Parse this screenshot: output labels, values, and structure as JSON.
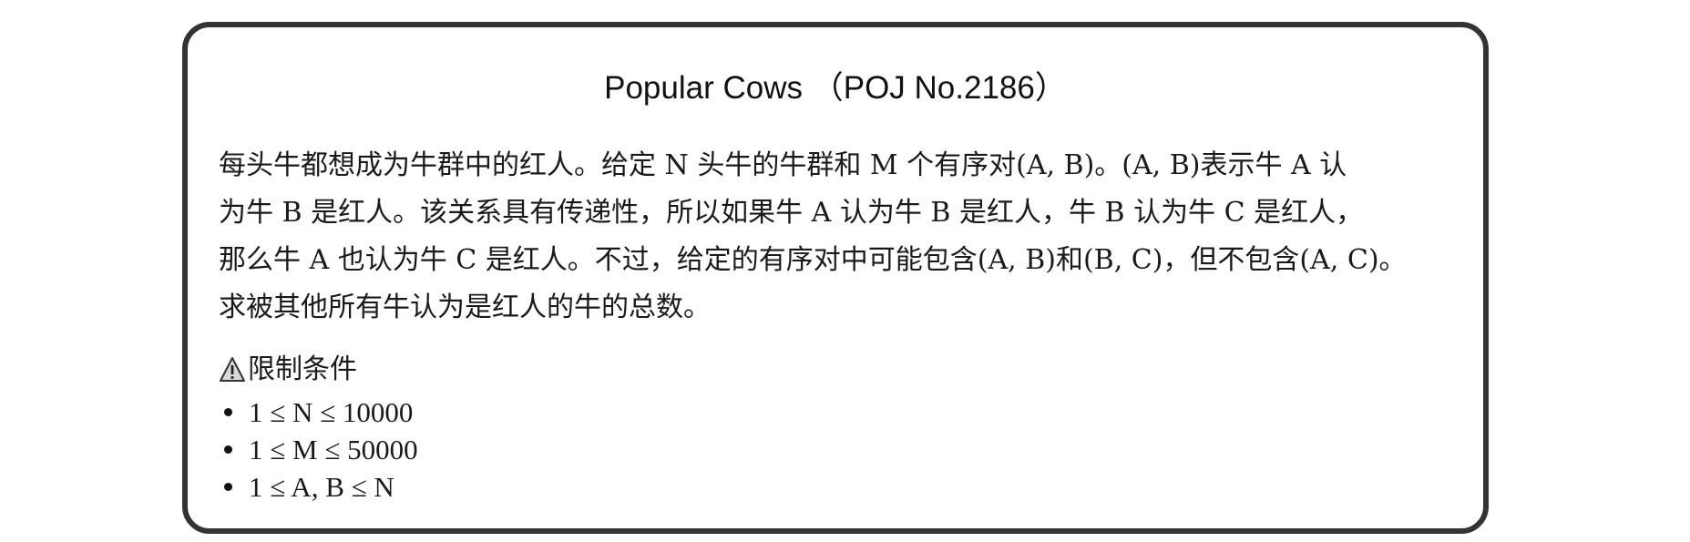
{
  "title": "Popular Cows （POJ No.2186）",
  "description_lines": [
    "每头牛都想成为牛群中的红人。给定 N 头牛的牛群和 M 个有序对(A, B)。(A, B)表示牛 A 认",
    "为牛 B 是红人。该关系具有传递性，所以如果牛 A 认为牛 B 是红人，牛 B 认为牛 C 是红人，",
    "那么牛 A 也认为牛 C 是红人。不过，给定的有序对中可能包含(A, B)和(B, C)，但不包含(A, C)。",
    "求被其他所有牛认为是红人的牛的总数。"
  ],
  "constraints": {
    "heading": "限制条件",
    "icon": "warning-icon",
    "items": [
      "1 ≤ N ≤ 10000",
      "1 ≤ M ≤ 50000",
      "1 ≤ A, B ≤ N"
    ]
  },
  "colors": {
    "border": "#333333",
    "text": "#1a1a1a",
    "background": "#ffffff"
  }
}
